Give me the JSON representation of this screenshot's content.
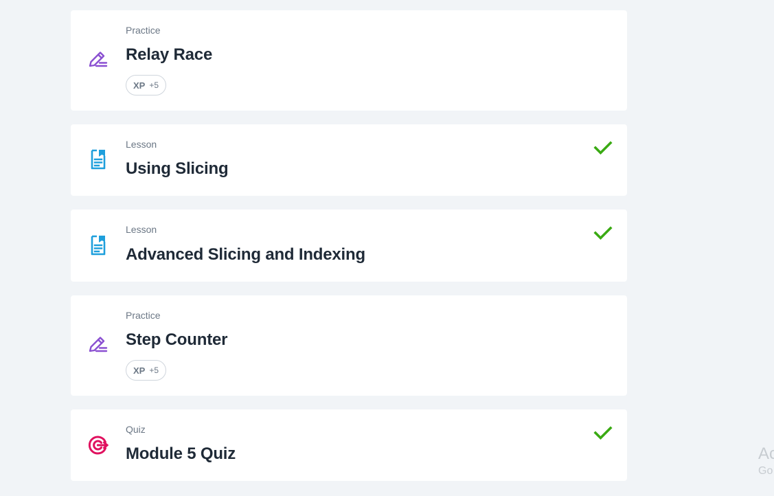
{
  "items": [
    {
      "type": "Practice",
      "title": "Relay Race",
      "xp_label": "XP",
      "xp_value": "+5",
      "completed": false,
      "icon": "pencil-icon"
    },
    {
      "type": "Lesson",
      "title": "Using Slicing",
      "completed": true,
      "icon": "document-icon"
    },
    {
      "type": "Lesson",
      "title": "Advanced Slicing and Indexing",
      "completed": true,
      "icon": "document-icon"
    },
    {
      "type": "Practice",
      "title": "Step Counter",
      "xp_label": "XP",
      "xp_value": "+5",
      "completed": false,
      "icon": "pencil-icon"
    },
    {
      "type": "Quiz",
      "title": "Module 5 Quiz",
      "completed": true,
      "icon": "target-icon"
    }
  ],
  "watermark": {
    "line1": "Ac",
    "line2": "Go"
  },
  "colors": {
    "practice_icon": "#8a4fd1",
    "lesson_icon": "#1e9fdc",
    "quiz_icon": "#e0115f",
    "check": "#3aaa13",
    "background": "#f1f4f7"
  }
}
